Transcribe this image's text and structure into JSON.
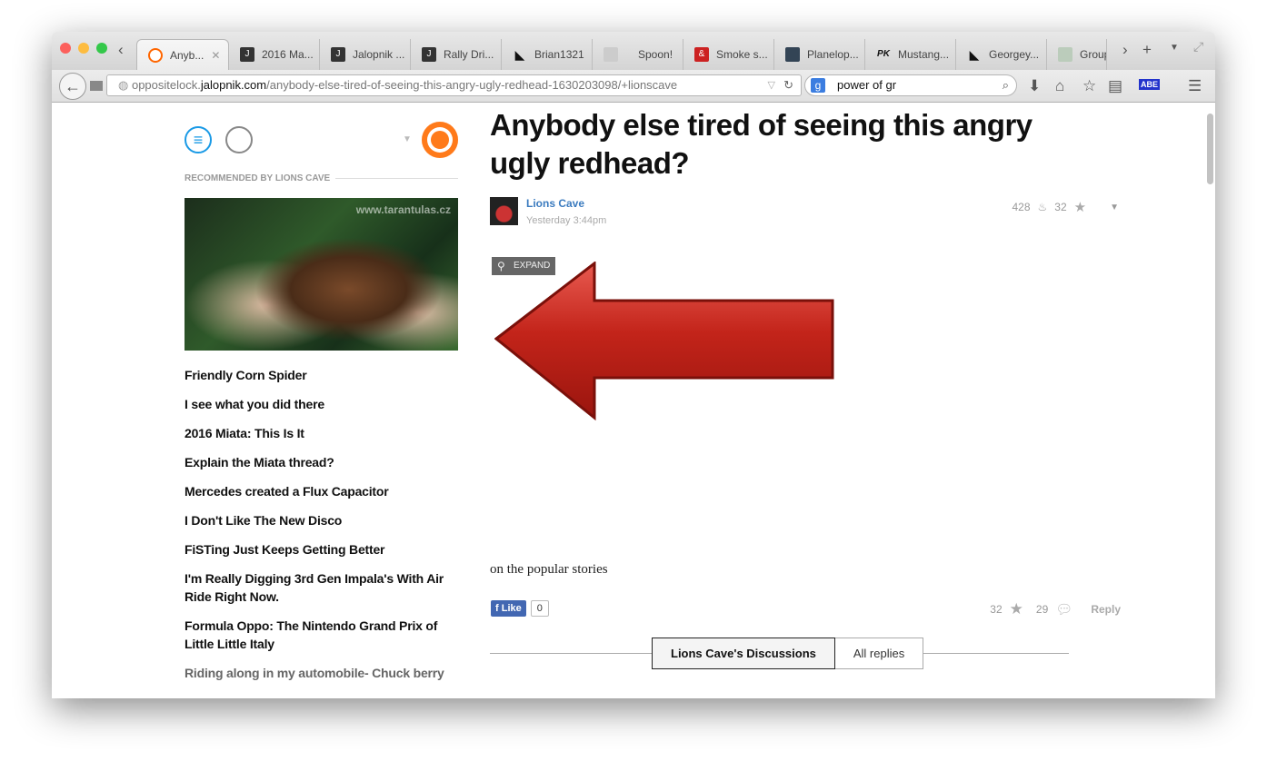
{
  "browser": {
    "tabs": [
      {
        "label": "Anyb...",
        "active": true
      },
      {
        "label": "2016 Ma..."
      },
      {
        "label": "Jalopnik ..."
      },
      {
        "label": "Rally Dri..."
      },
      {
        "label": "Brian1321"
      },
      {
        "label": "Spoon!"
      },
      {
        "label": "Smoke s..."
      },
      {
        "label": "Planelop..."
      },
      {
        "label": "Mustang..."
      },
      {
        "label": "Georgey..."
      },
      {
        "label": "Group"
      }
    ],
    "url_domain": "oppositelock.jalopnik.com",
    "url_host_pre": "oppositelock.",
    "url_host_bold": "jalopnik.com",
    "url_path": "/anybody-else-tired-of-seeing-this-angry-ugly-redhead-1630203098/+lionscave",
    "search_value": "power of gr",
    "search_engine_icon": "g",
    "addon_label": "ABE"
  },
  "sidebar": {
    "recommended_label": "RECOMMENDED BY LIONS CAVE",
    "image_watermark": "www.tarantulas.cz",
    "links": [
      "Friendly Corn Spider",
      "I see what you did there",
      "2016 Miata: This Is It",
      "Explain the Miata thread?",
      "Mercedes created a Flux Capacitor",
      "I Don't Like The New Disco",
      "FiSTing Just Keeps Getting Better",
      "I'm Really Digging 3rd Gen Impala's With Air Ride Right Now.",
      "Formula Oppo: The Nintendo Grand Prix of Little Little Italy",
      "Riding along in my automobile- Chuck berry"
    ],
    "accent": "#ff7a1a"
  },
  "post": {
    "title": "Anybody else tired of seeing this angry ugly redhead?",
    "author": "Lions Cave",
    "time": "Yesterday 3:44pm",
    "views": "428",
    "stars": "32",
    "expand_label": "EXPAND",
    "body": "on the popular stories",
    "fb_like": "Like",
    "fb_count": "0",
    "footer_stars": "32",
    "footer_comments": "29",
    "reply_label": "Reply",
    "discussion_tabs": [
      "Lions Cave's Discussions",
      "All replies"
    ]
  }
}
